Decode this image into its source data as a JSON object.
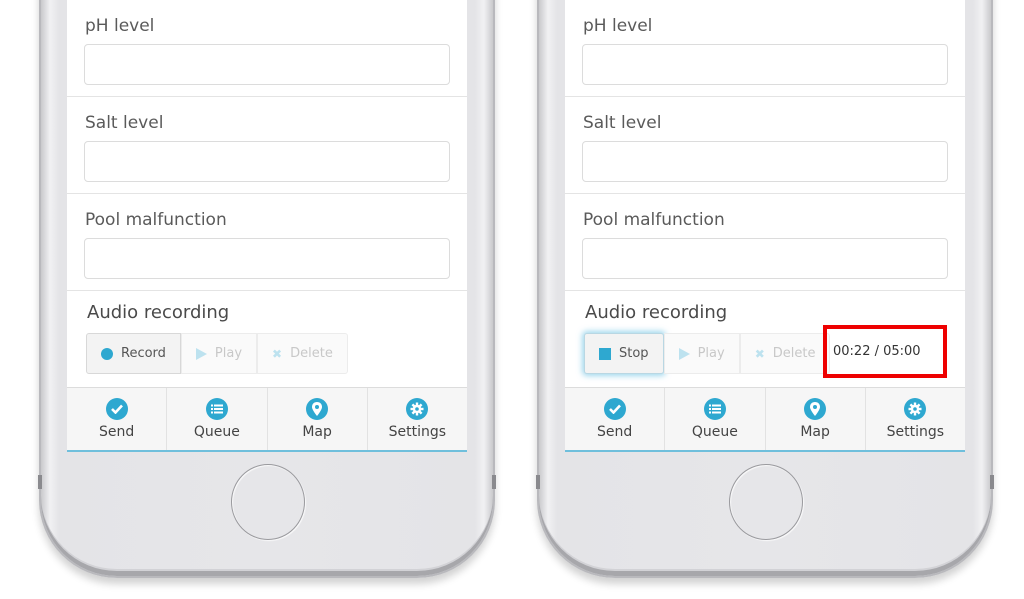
{
  "phones": [
    {
      "fields": [
        {
          "label": "pH level",
          "value": ""
        },
        {
          "label": "Salt level",
          "value": ""
        },
        {
          "label": "Pool malfunction",
          "value": ""
        }
      ],
      "audio": {
        "title": "Audio recording",
        "primary_button": "Record",
        "play_button": "Play",
        "delete_button": "Delete"
      },
      "tabs": [
        {
          "label": "Send",
          "icon": "check-circle-icon"
        },
        {
          "label": "Queue",
          "icon": "list-circle-icon"
        },
        {
          "label": "Map",
          "icon": "map-marker-icon"
        },
        {
          "label": "Settings",
          "icon": "gear-icon"
        }
      ]
    },
    {
      "fields": [
        {
          "label": "pH level",
          "value": ""
        },
        {
          "label": "Salt level",
          "value": ""
        },
        {
          "label": "Pool malfunction",
          "value": ""
        }
      ],
      "audio": {
        "title": "Audio recording",
        "primary_button": "Stop",
        "play_button": "Play",
        "delete_button": "Delete",
        "timer": "00:22 / 05:00"
      },
      "tabs": [
        {
          "label": "Send",
          "icon": "check-circle-icon"
        },
        {
          "label": "Queue",
          "icon": "list-circle-icon"
        },
        {
          "label": "Map",
          "icon": "map-marker-icon"
        },
        {
          "label": "Settings",
          "icon": "gear-icon"
        }
      ]
    }
  ],
  "colors": {
    "accent": "#2ea8d0",
    "highlight_box": "#ee0000"
  }
}
